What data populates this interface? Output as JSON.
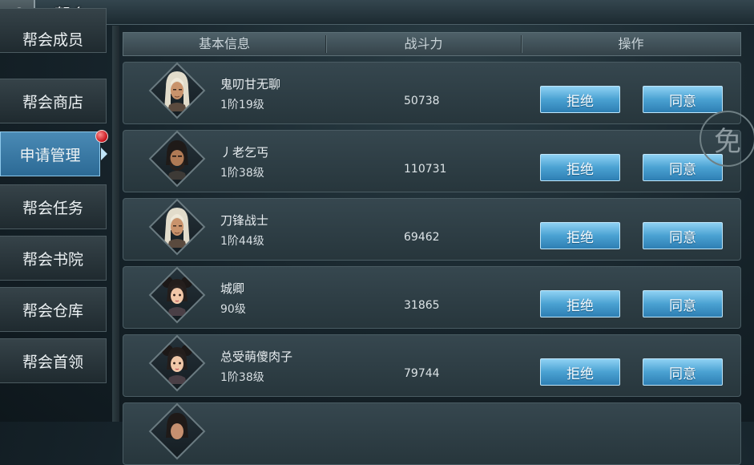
{
  "header": {
    "title": "帮会"
  },
  "sidebar": {
    "items": [
      {
        "label": "帮会成员"
      },
      {
        "label": "帮会商店"
      },
      {
        "label": "申请管理"
      },
      {
        "label": "帮会任务"
      },
      {
        "label": "帮会书院"
      },
      {
        "label": "帮会仓库"
      },
      {
        "label": "帮会首领"
      }
    ]
  },
  "table": {
    "columns": [
      "基本信息",
      "战斗力",
      "操作"
    ],
    "reject_label": "拒绝",
    "accept_label": "同意",
    "rows": [
      {
        "name": "鬼叨甘无聊",
        "level": "1阶19级",
        "power": "50738",
        "avatar": "white-haired-male"
      },
      {
        "name": "丿老乞丐",
        "level": "1阶38级",
        "power": "110731",
        "avatar": "bearded-male"
      },
      {
        "name": "刀锋战士",
        "level": "1阶44级",
        "power": "69462",
        "avatar": "white-haired-male"
      },
      {
        "name": "城卿",
        "level": "90级",
        "power": "31865",
        "avatar": "bun-haired-female"
      },
      {
        "name": "总受萌傻肉子",
        "level": "1阶38级",
        "power": "79744",
        "avatar": "bun-haired-female"
      },
      {
        "name": "",
        "level": "",
        "power": "",
        "avatar": "dark-haired"
      }
    ]
  },
  "side_badge": {
    "label": "免"
  },
  "colors": {
    "accent": "#4aa1d2",
    "active_tab": "#3a7aa5",
    "notification": "#c4121a"
  }
}
